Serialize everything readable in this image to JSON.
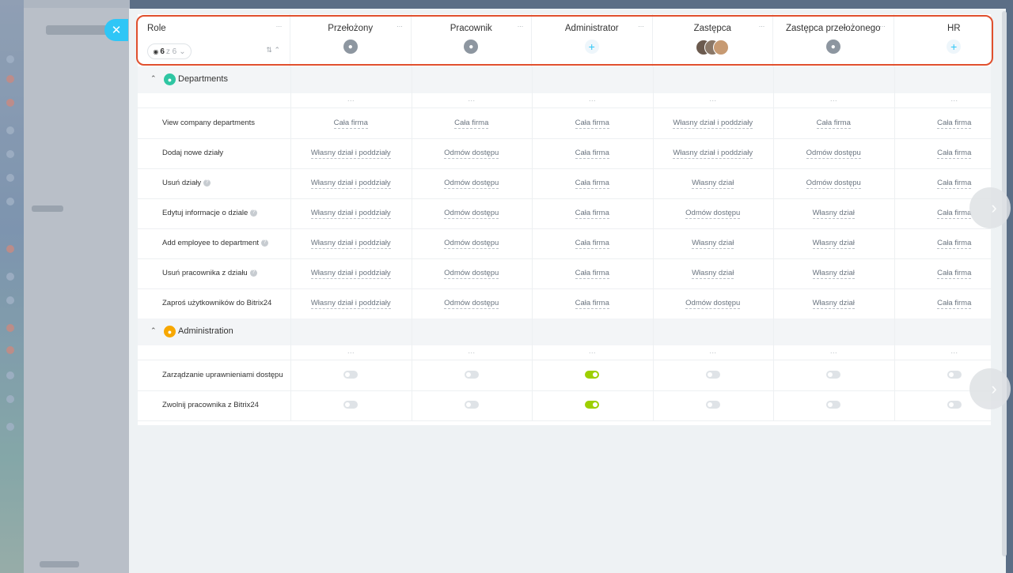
{
  "header": {
    "role_title": "Role",
    "role_counter_value": "6",
    "role_counter_suffix": "z 6",
    "sort_icon": "sort-icon",
    "columns": [
      {
        "name": "Przełożony",
        "icon": "user-group-icon"
      },
      {
        "name": "Pracownik",
        "icon": "user-icon"
      },
      {
        "name": "Administrator",
        "icon": "plus-icon"
      },
      {
        "name": "Zastępca",
        "icon": "avatars-icon"
      },
      {
        "name": "Zastępca przełożonego",
        "icon": "user-group-icon"
      },
      {
        "name": "HR",
        "icon": "plus-icon"
      }
    ],
    "dots": "···"
  },
  "sections": [
    {
      "name": "Departments",
      "icon_color": "#2fc6a3",
      "rows": [
        {
          "label": "View company departments",
          "values": [
            "Cała firma",
            "Cała firma",
            "Cała firma",
            "Własny dział i poddziały",
            "Cała firma",
            "Cała firma"
          ]
        },
        {
          "label": "Dodaj nowe działy",
          "values": [
            "Własny dział i poddziały",
            "Odmów dostępu",
            "Cała firma",
            "Własny dział i poddziały",
            "Odmów dostępu",
            "Cała firma"
          ]
        },
        {
          "label": "Usuń działy",
          "values": [
            "Własny dział i poddziały",
            "Odmów dostępu",
            "Cała firma",
            "Własny dział",
            "Odmów dostępu",
            "Cała firma"
          ]
        },
        {
          "label": "Edytuj informacje o dziale",
          "values": [
            "Własny dział i poddziały",
            "Odmów dostępu",
            "Cała firma",
            "Odmów dostępu",
            "Własny dział",
            "Cała firma"
          ]
        },
        {
          "label": "Add employee to department",
          "values": [
            "Własny dział i poddziały",
            "Odmów dostępu",
            "Cała firma",
            "Własny dział",
            "Własny dział",
            "Cała firma"
          ]
        },
        {
          "label": "Usuń pracownika z działu",
          "values": [
            "Własny dział i poddziały",
            "Odmów dostępu",
            "Cała firma",
            "Własny dział",
            "Własny dział",
            "Cała firma"
          ]
        },
        {
          "label": "Zaproś użytkowników do Bitrix24",
          "values": [
            "Własny dział i poddziały",
            "Odmów dostępu",
            "Cała firma",
            "Odmów dostępu",
            "Własny dział",
            "Cała firma"
          ]
        }
      ]
    },
    {
      "name": "Administration",
      "icon_color": "#f7a700",
      "rows": [
        {
          "label": "Zarządzanie uprawnieniami dostępu",
          "toggles": [
            false,
            false,
            true,
            false,
            false,
            false
          ]
        },
        {
          "label": "Zwolnij pracownika z Bitrix24",
          "toggles": [
            false,
            false,
            true,
            false,
            false,
            false
          ]
        }
      ]
    }
  ],
  "colors": {
    "accent": "#2fc6f6",
    "toggle_on": "#9dcf00",
    "highlight": "#e0502e"
  }
}
